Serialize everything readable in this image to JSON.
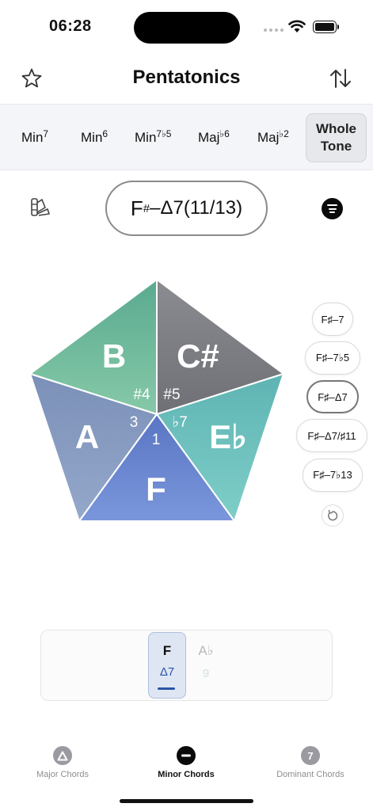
{
  "status": {
    "time": "06:28"
  },
  "header": {
    "title": "Pentatonics"
  },
  "chord_types": [
    {
      "base": "Min",
      "sup": "7",
      "state": "dim"
    },
    {
      "base": "Min",
      "sup": "6",
      "state": "on"
    },
    {
      "base": "Min",
      "sup": "7♭5",
      "state": "dim"
    },
    {
      "base": "Maj",
      "sup": "♭6",
      "state": "on"
    },
    {
      "base": "Maj",
      "sup": "♭2",
      "state": "dim"
    }
  ],
  "chord_type_selected": {
    "line1": "Whole",
    "line2": "Tone"
  },
  "current_chord": {
    "root": "F",
    "accidental": "#",
    "quality": "–Δ7",
    "extensions": "(11/13)"
  },
  "pentagon": {
    "notes": {
      "top_left": "B",
      "top_right": "C#",
      "left": "A",
      "right": "E♭",
      "bottom": "F"
    },
    "intervals": {
      "top_left": "#4",
      "top_right": "#5",
      "left": "3",
      "right": "♭7",
      "bottom": "1"
    },
    "colors": {
      "b": "#6cbf9b",
      "csharp": "#86878d",
      "a": "#8699bf",
      "e": "#6cc0bd",
      "f": "#6d88d0"
    }
  },
  "chord_list": [
    {
      "label": "F♯–7",
      "selected": false
    },
    {
      "label": "F♯–7♭5",
      "selected": false
    },
    {
      "label": "F♯–Δ7",
      "selected": true
    },
    {
      "label": "F♯–Δ7/♯11",
      "selected": false
    },
    {
      "label": "F♯–7♭13",
      "selected": false
    }
  ],
  "selector": {
    "active": {
      "note": "F",
      "chord": "Δ7"
    },
    "inactive": {
      "note": "A♭",
      "chord": "9"
    }
  },
  "tabs": [
    {
      "label": "Major Chords",
      "icon": "Δ",
      "color": "#9a9aa0",
      "active": false
    },
    {
      "label": "Minor Chords",
      "icon": "–",
      "color": "#0a0a0a",
      "active": true
    },
    {
      "label": "Dominant Chords",
      "icon": "7",
      "color": "#9a9aa0",
      "active": false
    }
  ]
}
